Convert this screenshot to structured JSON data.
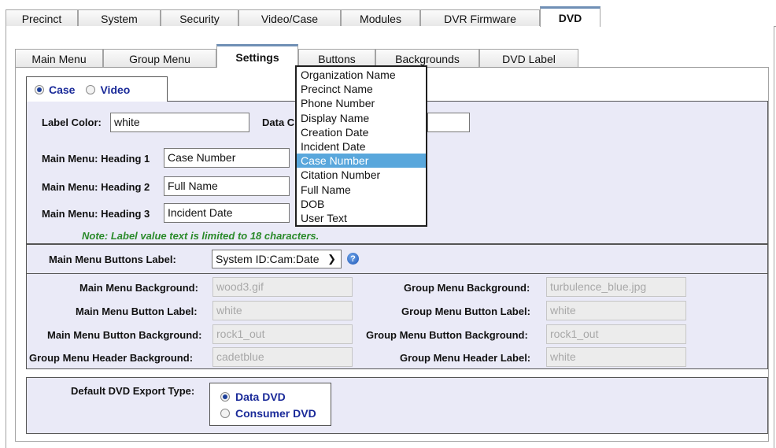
{
  "top_tabs": [
    "Precinct",
    "System",
    "Security",
    "Video/Case",
    "Modules",
    "DVR Firmware",
    "DVD"
  ],
  "sub_tabs": [
    "Main Menu",
    "Group Menu",
    "Settings",
    "Buttons",
    "Backgrounds",
    "DVD Label"
  ],
  "mode": {
    "case_label": "Case",
    "video_label": "Video",
    "selected": "Case"
  },
  "labels": {
    "label_color": "Label Color:",
    "label_color_value": "white",
    "data_label_partial": "Data C",
    "heading1": "Main Menu: Heading 1",
    "heading1_value": "Case Number",
    "heading2": "Main Menu: Heading 2",
    "heading2_value": "Full Name",
    "heading3": "Main Menu: Heading 3",
    "heading3_value": "Incident Date",
    "note": "Note: Label value text is limited to 18 characters."
  },
  "buttons_label": {
    "label": "Main Menu Buttons Label:",
    "value": "System ID:Cam:Date",
    "help_icon": "help-icon"
  },
  "backgrounds": {
    "main_menu_background_label": "Main Menu Background:",
    "main_menu_background": "wood3.gif",
    "main_menu_button_label_label": "Main Menu Button Label:",
    "main_menu_button_label": "white",
    "main_menu_button_background_label": "Main Menu Button Background:",
    "main_menu_button_background": "rock1_out",
    "group_menu_header_background_label": "Group Menu Header Background:",
    "group_menu_header_background": "cadetblue",
    "group_menu_background_label": "Group Menu Background:",
    "group_menu_background": "turbulence_blue.jpg",
    "group_menu_button_label_label": "Group Menu Button Label:",
    "group_menu_button_label": "white",
    "group_menu_button_background_label": "Group Menu Button Background:",
    "group_menu_button_background": "rock1_out",
    "group_menu_header_label_label": "Group Menu Header Label:",
    "group_menu_header_label": "white"
  },
  "export": {
    "label": "Default DVD Export Type:",
    "data_dvd": "Data DVD",
    "consumer_dvd": "Consumer DVD",
    "selected": "Data DVD"
  },
  "dropdown": {
    "items": [
      "Organization Name",
      "Precinct Name",
      "Phone Number",
      "Display Name",
      "Creation Date",
      "Incident Date",
      "Case Number",
      "Citation Number",
      "Full Name",
      "DOB",
      "User Text"
    ],
    "highlighted": "Case Number"
  },
  "colors": {
    "panel_bg": "#eaeaf7",
    "highlight": "#59a7dc",
    "note_green": "#2a8a2a",
    "radio_label_blue": "#1a2a99"
  }
}
